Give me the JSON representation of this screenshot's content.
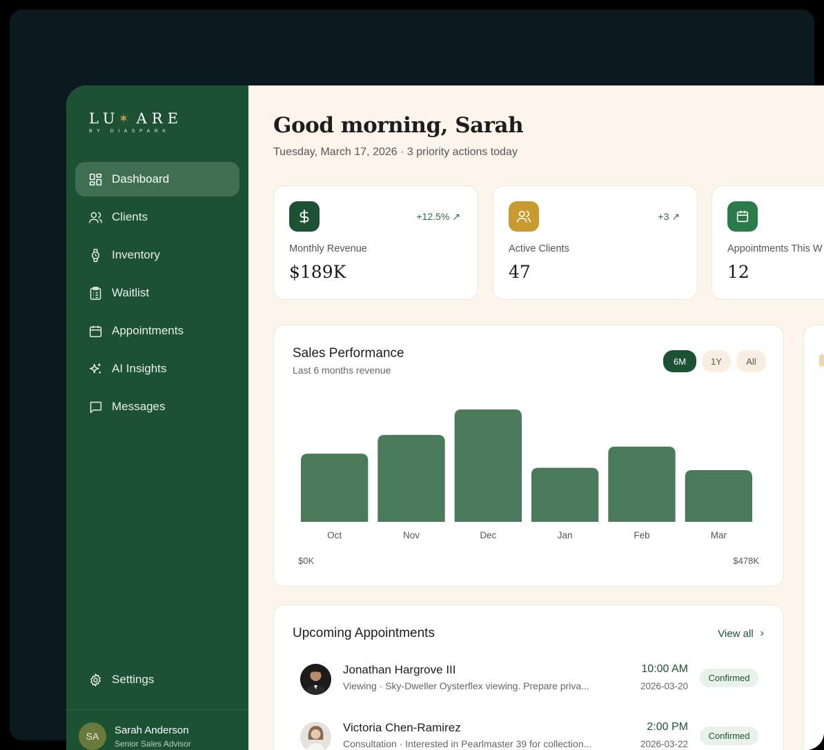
{
  "brand": {
    "name_left": "LU",
    "name_star": "✶",
    "name_right": "ARE",
    "sub": "BY DIASPARK"
  },
  "nav": {
    "items": [
      {
        "label": "Dashboard",
        "icon": "dashboard-icon",
        "active": true
      },
      {
        "label": "Clients",
        "icon": "users-icon"
      },
      {
        "label": "Inventory",
        "icon": "watch-icon"
      },
      {
        "label": "Waitlist",
        "icon": "clipboard-list-icon"
      },
      {
        "label": "Appointments",
        "icon": "calendar-icon"
      },
      {
        "label": "AI Insights",
        "icon": "sparkles-icon"
      },
      {
        "label": "Messages",
        "icon": "message-icon"
      }
    ],
    "settings": {
      "label": "Settings",
      "icon": "gear-icon"
    }
  },
  "user": {
    "initials": "SA",
    "name": "Sarah Anderson",
    "role": "Senior Sales Advisor"
  },
  "header": {
    "greeting": "Good morning, Sarah",
    "subline": "Tuesday, March 17, 2026 · 3 priority actions today"
  },
  "stats": [
    {
      "label": "Monthly Revenue",
      "value": "$189K",
      "trend": "+12.5% ↗",
      "icon": "dollar-icon",
      "color": "#1c5233"
    },
    {
      "label": "Active Clients",
      "value": "47",
      "trend": "+3 ↗",
      "icon": "users-icon",
      "color": "#c99a2e"
    },
    {
      "label": "Appointments This W",
      "value": "12",
      "trend": "",
      "icon": "calendar-icon",
      "color": "#2a7a4a"
    }
  ],
  "sales": {
    "title": "Sales Performance",
    "subtitle": "Last 6 months revenue",
    "ranges": [
      "6M",
      "1Y",
      "All"
    ],
    "active_range": "6M",
    "min_label": "$0K",
    "max_label": "$478K"
  },
  "chart_data": {
    "type": "bar",
    "categories": [
      "Oct",
      "Nov",
      "Dec",
      "Jan",
      "Feb",
      "Mar"
    ],
    "values": [
      290,
      370,
      478,
      230,
      320,
      220
    ],
    "ylim": [
      0,
      478
    ],
    "grid": false,
    "bar_color": "#4a7a5a"
  },
  "appointments": {
    "title": "Upcoming Appointments",
    "view_all": "View all",
    "items": [
      {
        "name": "Jonathan Hargrove III",
        "desc": "Viewing · Sky-Dweller Oysterflex viewing. Prepare priva...",
        "time": "10:00 AM",
        "date": "2026-03-20",
        "status": "Confirmed"
      },
      {
        "name": "Victoria Chen-Ramirez",
        "desc": "Consultation · Interested in Pearlmaster 39 for collection...",
        "time": "2:00 PM",
        "date": "2026-03-22",
        "status": "Confirmed"
      }
    ]
  }
}
